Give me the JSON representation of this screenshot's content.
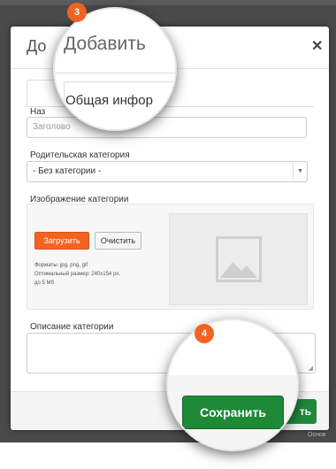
{
  "backdrop": {
    "footer_fragment": "Основ"
  },
  "modal": {
    "title_fragment": "До",
    "close_icon": "close-icon",
    "tab_fragment": "о",
    "fields": {
      "name_label": "Наз",
      "name_placeholder": "Заголово",
      "parent_label": "Родительская категория",
      "parent_value": "- Без категории -",
      "image_label": "Изображение категории",
      "upload_label": "Загрузить",
      "clear_label": "Очистить",
      "formats": "Форматы: jpg, png, gif",
      "size_hint": "Оптимальный размер: 240x154 px,",
      "max_size": "до 5 Мб",
      "description_label": "Описание категории"
    },
    "footer": {
      "save_fragment": "ть"
    }
  },
  "callouts": {
    "step3": {
      "badge": "3",
      "title": "Добавить",
      "tab_label": "Общая инфор",
      "tab_red_fragment": "о"
    },
    "step4": {
      "badge": "4",
      "button": "Сохранить"
    }
  },
  "colors": {
    "accent_orange": "#f26322",
    "save_green": "#1e8a38"
  }
}
